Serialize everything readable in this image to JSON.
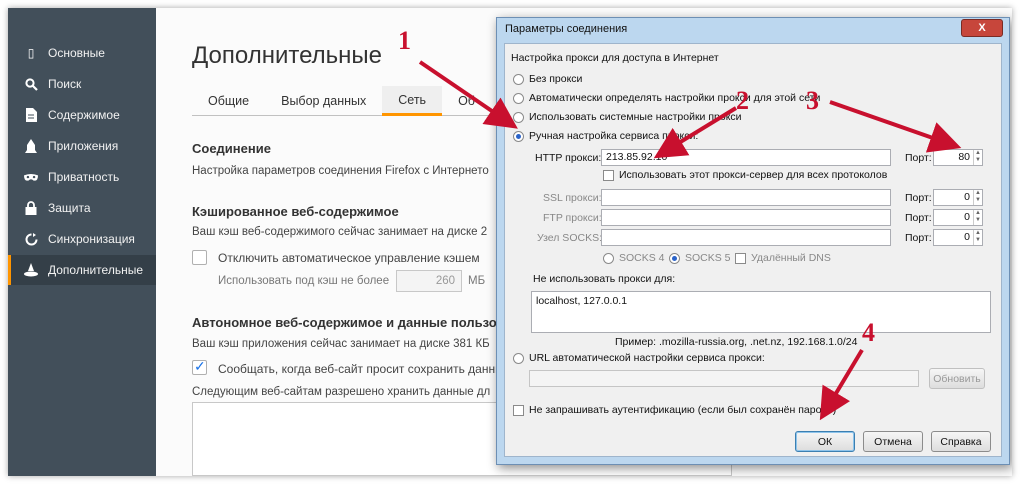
{
  "sidebar": {
    "items": [
      {
        "label": "Основные",
        "icon": "general-icon"
      },
      {
        "label": "Поиск",
        "icon": "search-icon"
      },
      {
        "label": "Содержимое",
        "icon": "content-icon"
      },
      {
        "label": "Приложения",
        "icon": "applications-icon"
      },
      {
        "label": "Приватность",
        "icon": "privacy-mask-icon"
      },
      {
        "label": "Защита",
        "icon": "lock-icon"
      },
      {
        "label": "Синхронизация",
        "icon": "sync-icon"
      },
      {
        "label": "Дополнительные",
        "icon": "advanced-hat-icon"
      }
    ],
    "active_index": 7
  },
  "main": {
    "title": "Дополнительные",
    "tabs": [
      "Общие",
      "Выбор данных",
      "Сеть",
      "Об"
    ],
    "active_tab": 2,
    "connection_title": "Соединение",
    "connection_text": "Настройка параметров соединения Firefox с Интернето",
    "cache_title": "Кэшированное веб-содержимое",
    "cache_text": "Ваш кэш веб-содержимого сейчас занимает на диске 2",
    "cache_override_label": "Отключить автоматическое управление кэшем",
    "cache_limit_label": "Использовать под кэш не более",
    "cache_limit_value": "260",
    "cache_unit": "МБ",
    "offline_title": "Автономное веб-содержимое и данные пользов",
    "offline_text": "Ваш кэш приложения сейчас занимает на диске 381 КБ",
    "offline_notify_label": "Сообщать, когда веб-сайт просит сохранить данные",
    "offline_allowed_text": "Следующим веб-сайтам разрешено хранить данные дл"
  },
  "dialog": {
    "title": "Параметры соединения",
    "close_label": "X",
    "group_label": "Настройка прокси для доступа в Интернет",
    "radios": [
      "Без прокси",
      "Автоматически определять настройки прокси для этой сети",
      "Использовать системные настройки прокси",
      "Ручная настройка сервиса прокси:"
    ],
    "selected_radio": 3,
    "http_label": "HTTP прокси:",
    "http_value": "213.85.92.10",
    "port_label": "Порт:",
    "http_port": "80",
    "same_proxy_label": "Использовать этот прокси-сервер для всех протоколов",
    "ssl_label": "SSL прокси:",
    "ssl_port": "0",
    "ftp_label": "FTP прокси:",
    "ftp_port": "0",
    "socks_label": "Узел SOCKS:",
    "socks_port": "0",
    "socks4_label": "SOCKS 4",
    "socks5_label": "SOCKS 5",
    "remote_dns_label": "Удалённый DNS",
    "no_proxy_label": "Не использовать прокси для:",
    "no_proxy_value": "localhost, 127.0.0.1",
    "example_text": "Пример: .mozilla-russia.org, .net.nz, 192.168.1.0/24",
    "pac_label": "URL автоматической настройки сервиса прокси:",
    "reload_label": "Обновить",
    "no_auth_label": "Не запрашивать аутентификацию (если был сохранён пароль)",
    "ok_label": "ОК",
    "cancel_label": "Отмена",
    "help_label": "Справка"
  },
  "annotations": {
    "color": "#c8102e",
    "labels": [
      "1",
      "2",
      "3",
      "4"
    ]
  }
}
